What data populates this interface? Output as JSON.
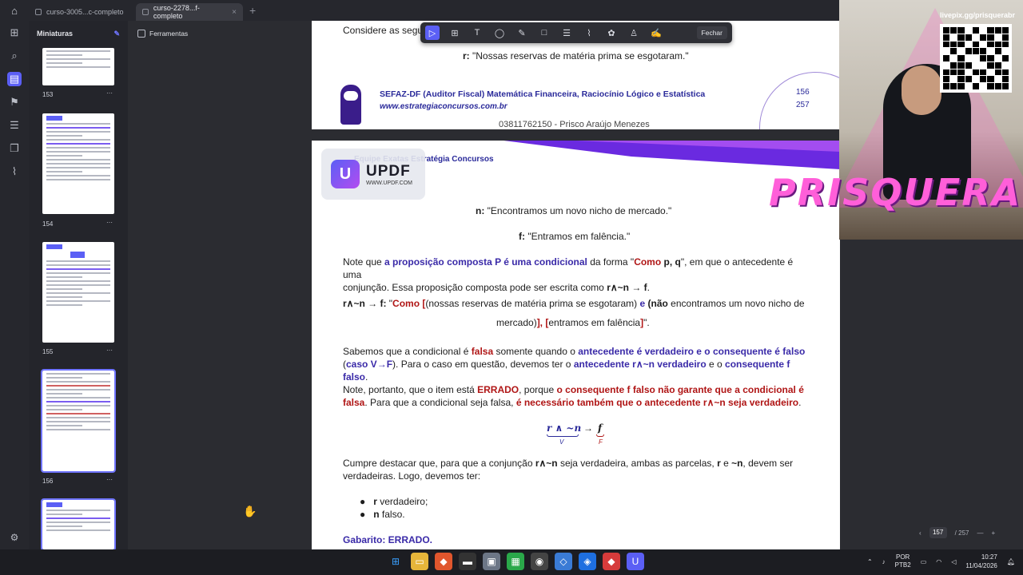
{
  "tabs": [
    {
      "label": "curso-3005...c-completo",
      "active": false
    },
    {
      "label": "curso-2278...f-completo",
      "active": true
    }
  ],
  "sidebar": {
    "title": "Miniaturas",
    "thumbnails": [
      {
        "label": "153"
      },
      {
        "label": "154"
      },
      {
        "label": "155"
      },
      {
        "label": "156"
      }
    ]
  },
  "tools_label": "Ferramentas",
  "floating_toolbar": {
    "close_label": "Fechar",
    "icons": [
      "select-icon",
      "textbox-icon",
      "text-icon",
      "comment-icon",
      "highlighter-icon",
      "shape-icon",
      "strikethrough-icon",
      "attach-icon",
      "sticker-icon",
      "stamp-icon",
      "signature-icon"
    ]
  },
  "page1": {
    "intro": "Considere as segu",
    "r_label": "r:",
    "r_text": " \"Nossas reservas de matéria prima se esgotaram.\"",
    "footer_course": "SEFAZ-DF (Auditor Fiscal) Matemática Financeira, Raciocínio Lógico e Estatística",
    "footer_site": "www.estrategiaconcursos.com.br",
    "footer_owner": "03811762150 - Prisco Araújo Menezes",
    "page_num": "156",
    "page_total": "257"
  },
  "page2": {
    "header_line": "Equipe Exatas Estratégia Concursos",
    "n_label": "n:",
    "n_text": " \"Encontramos um novo nicho de mercado.\"",
    "f_label": "f:",
    "f_text": " \"Entramos em falência.\"",
    "para1_a": "Note que ",
    "para1_b": "a proposição composta P é uma condicional",
    "para1_c": " da forma \"",
    "para1_d": "Como",
    "para1_e": " p, q",
    "para1_f": "\", em que o antecedente é uma",
    "para1_g": "conjunção. Essa proposição composta pode ser escrita como ",
    "para1_h": "r∧~n → f",
    "para1_i": ".",
    "formula_a": "r∧~n → f:",
    "formula_b": " \"",
    "formula_c": "Como [",
    "formula_d": "(nossas reservas de matéria prima se esgotaram)",
    "formula_e": " e ",
    "formula_f": "(não",
    "formula_g": " encontramos um novo nicho de",
    "formula_h": "mercado)",
    "formula_i": "], [",
    "formula_j": "entramos em falência",
    "formula_k": "]",
    "formula_l": "\".",
    "para2_a": "Sabemos que a condicional é ",
    "para2_b": "falsa",
    "para2_c": " somente quando o ",
    "para2_d": "antecedente é verdadeiro e o consequente é falso",
    "para2_e": "(",
    "para2_f": "caso V→F",
    "para2_g": "). Para o caso em questão, devemos ter o ",
    "para2_h": "antecedente r∧~n verdadeiro",
    "para2_i": " e o ",
    "para2_j": "consequente f falso",
    "para2_k": ".",
    "para3_a": "Note, portanto, que o item está ",
    "para3_b": "ERRADO",
    "para3_c": ", porque ",
    "para3_d": "o consequente f falso não garante que a condicional é",
    "para3_e": "falsa",
    "para3_f": ". Para que a condicional seja falsa, ",
    "para3_g": "é necessário também que o antecedente r∧~n seja verdadeiro",
    "para3_h": ".",
    "math_left": "r ∧ ~n",
    "math_arrow": "→",
    "math_right": "f",
    "math_v": "V",
    "math_f": "F",
    "para4_a": "Cumpre destacar que, para que a conjunção ",
    "para4_b": "r∧~n",
    "para4_c": " seja verdadeira, ambas as parcelas, ",
    "para4_d": "r",
    "para4_e": " e ",
    "para4_f": "~n",
    "para4_g": ", devem ser",
    "para4_h": "verdadeiras. Logo, devemos ter:",
    "bullet1_a": "r",
    "bullet1_b": " verdadeiro;",
    "bullet2_a": "n",
    "bullet2_b": " falso.",
    "gabarito": "Gabarito: ERRADO."
  },
  "updf": {
    "name": "UPDF",
    "url": "WWW.UPDF.COM"
  },
  "stream": {
    "name": "PRISQUERA",
    "qr_label": "livepix.gg/prisquerabr"
  },
  "pager": {
    "current": "157",
    "total": "/ 257"
  },
  "tray": {
    "lang_top": "POR",
    "lang_bottom": "PTB2",
    "time": "10:27",
    "date": "11/04/2026"
  },
  "colors": {
    "accent": "#5b5ff5",
    "purple_text": "#3a2aa8",
    "red_text": "#b01616",
    "stream_pink": "#ff5fd9"
  }
}
